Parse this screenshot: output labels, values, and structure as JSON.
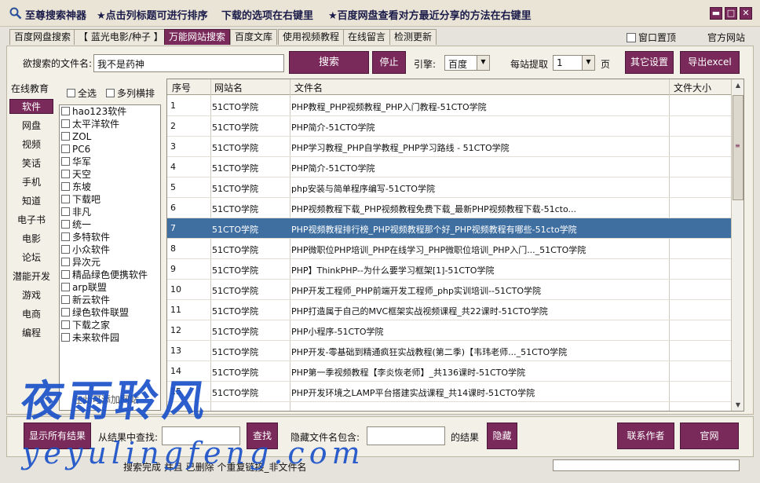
{
  "app": {
    "title": "至尊搜索神器",
    "hint1": "★点击列标题可进行排序",
    "hint2": "下载的选项在右键里",
    "hint3": "★百度网盘查看对方最近分享的方法在右键里",
    "min_symbol": "▬",
    "max_symbol": "□",
    "close_symbol": "✕"
  },
  "tabs": [
    "百度网盘搜索",
    "【 蓝光电影/种子 】",
    "万能网站搜索",
    "百度文库",
    "使用视频教程",
    "在线留言",
    "检测更新"
  ],
  "active_tab": "万能网站搜索",
  "window_pin_label": "窗口置顶",
  "official_site_link": "官方网站",
  "search": {
    "label": "欲搜索的文件名:",
    "value": "我不是药神",
    "search_button": "搜索",
    "stop_button": "停止",
    "engine_label": "引擎:",
    "engine_value": "百度",
    "per_site_label": "每站提取",
    "per_site_value": "1",
    "page_unit": "页",
    "other_settings_button": "其它设置",
    "export_button": "导出excel"
  },
  "categories": {
    "title": "在线教育",
    "items": [
      "软件",
      "网盘",
      "视频",
      "笑话",
      "手机",
      "知道",
      "电子书",
      "电影",
      "论坛",
      "潜能开发",
      "游戏",
      "电商",
      "编程"
    ],
    "active": "软件"
  },
  "site_options": {
    "select_all": "全选",
    "multi_column": "多列横排",
    "add_site": "在此可添加网站"
  },
  "sites": [
    "hao123软件",
    "太平洋软件",
    "ZOL",
    "PC6",
    "华军",
    "天空",
    "东坡",
    "下载吧",
    "非凡",
    "统一",
    "多特软件",
    "小众软件",
    "异次元",
    "精品绿色便携软件",
    "arp联盟",
    "新云软件",
    "绿色软件联盟",
    "下载之家",
    "未来软件园"
  ],
  "table": {
    "headers": [
      "序号",
      "网站名",
      "文件名",
      "文件大小"
    ],
    "rows": [
      {
        "no": "1",
        "site": "51CTO学院",
        "file": "PHP教程_PHP视频教程_PHP入门教程-51CTO学院"
      },
      {
        "no": "2",
        "site": "51CTO学院",
        "file": "PHP简介-51CTO学院"
      },
      {
        "no": "3",
        "site": "51CTO学院",
        "file": "PHP学习教程_PHP自学教程_PHP学习路线 - 51CTO学院"
      },
      {
        "no": "4",
        "site": "51CTO学院",
        "file": "PHP简介-51CTO学院"
      },
      {
        "no": "5",
        "site": "51CTO学院",
        "file": "php安装与简单程序编写-51CTO学院"
      },
      {
        "no": "6",
        "site": "51CTO学院",
        "file": "PHP视频教程下载_PHP视频教程免费下载_最新PHP视频教程下载-51cto..."
      },
      {
        "no": "7",
        "site": "51CTO学院",
        "file": "PHP视频教程排行榜_PHP视频教程那个好_PHP视频教程有哪些-51cto学院"
      },
      {
        "no": "8",
        "site": "51CTO学院",
        "file": "PHP微职位PHP培训_PHP在线学习_PHP微职位培训_PHP入门..._51CTO学院"
      },
      {
        "no": "9",
        "site": "51CTO学院",
        "file": "PHP】ThinkPHP--为什么要学习框架[1]-51CTO学院"
      },
      {
        "no": "10",
        "site": "51CTO学院",
        "file": "PHP开发工程师_PHP前端开发工程师_php实训培训--51CTO学院"
      },
      {
        "no": "11",
        "site": "51CTO学院",
        "file": "PHP打造属于自己的MVC框架实战视频课程_共22课时-51CTO学院"
      },
      {
        "no": "12",
        "site": "51CTO学院",
        "file": "PHP小程序-51CTO学院"
      },
      {
        "no": "13",
        "site": "51CTO学院",
        "file": "PHP开发-零基础到精通疯狂实战教程(第二季)【韦玮老师..._51CTO学院"
      },
      {
        "no": "14",
        "site": "51CTO学院",
        "file": "PHP第一季视频教程【李炎恢老师】_共136课时-51CTO学院"
      },
      {
        "no": "15",
        "site": "51CTO学院",
        "file": "PHP开发环境之LAMP平台搭建实战课程_共14课时-51CTO学院"
      }
    ],
    "selected_no": "7"
  },
  "bottom": {
    "show_all_button": "显示所有结果",
    "find_label": "从结果中查找:",
    "find_button": "查找",
    "hide_label": "隐藏文件名包含:",
    "hide_suffix": "的结果",
    "hide_button": "隐藏",
    "contact_button": "联系作者",
    "official_button": "官网",
    "status": "搜索完成 并且 已删除 个重复链接_非文件名"
  },
  "watermark": {
    "cn": "夜雨聆风",
    "en": "yeyulingfeng.com"
  },
  "colors": {
    "accent": "#7a2a5a",
    "selection": "#3f6fa0",
    "watermark": "#1b52c9"
  }
}
